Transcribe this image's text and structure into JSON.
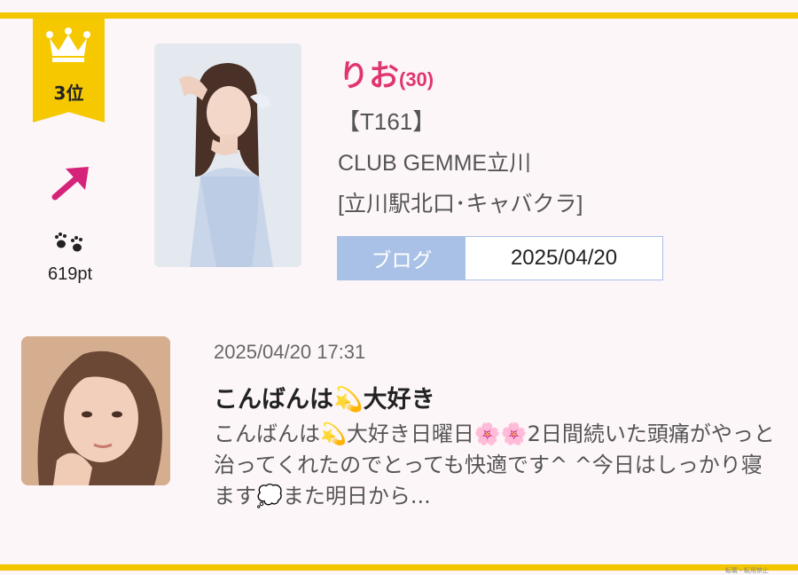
{
  "ranking": {
    "rank_label": "3位",
    "points": "619pt"
  },
  "profile": {
    "name": "りお",
    "age": "(30)",
    "height": "【T161】",
    "club": "CLUB GEMME立川",
    "location": "[立川駅北口･キャバクラ]",
    "blog_tab_label": "ブログ",
    "blog_date": "2025/04/20"
  },
  "post": {
    "timestamp": "2025/04/20 17:31",
    "title": "こんばんは💫大好き",
    "body": "こんばんは💫大好き日曜日🌸🌸2日間続いた頭痛がやっと治ってくれたのでとっても快適です^ ^今日はしっかり寝ます💭また明日から..."
  },
  "footer": {
    "watermark": "転載・転用禁止"
  },
  "colors": {
    "accent_yellow": "#f2c600",
    "name_pink": "#e0366e",
    "arrow_magenta": "#d6237a",
    "blog_blue": "#a9c1e6",
    "background": "#fdf6f8"
  },
  "icons": [
    "crown-icon",
    "trend-up-arrow-icon",
    "paw-icon"
  ]
}
